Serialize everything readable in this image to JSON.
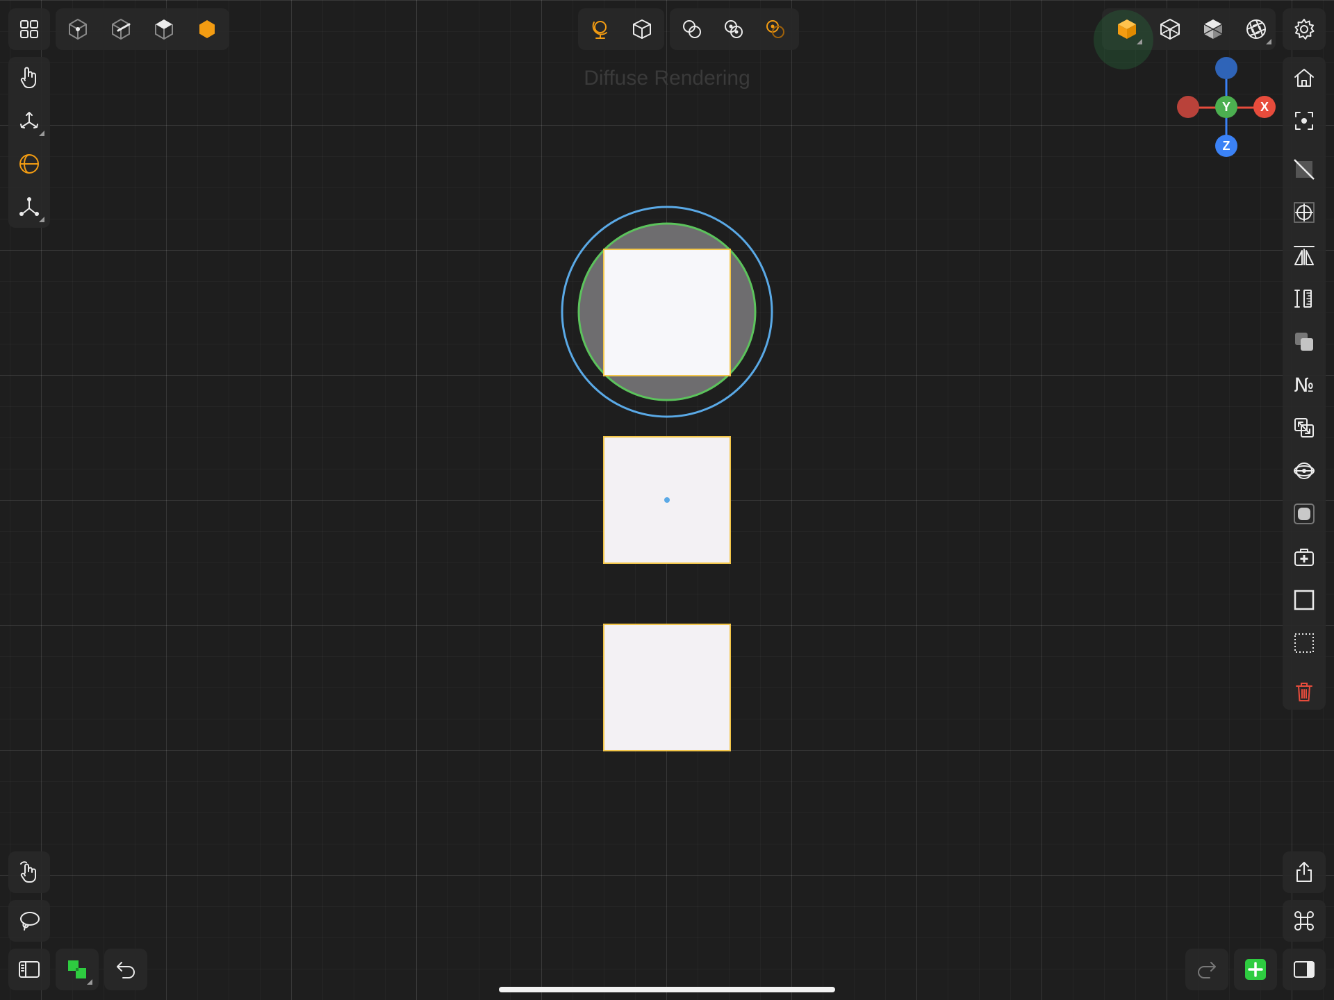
{
  "viewport": {
    "title": "Diffuse Rendering"
  },
  "gizmo": {
    "x_label": "X",
    "y_label": "Y",
    "z_label": "Z"
  },
  "colors": {
    "accent": "#f39c12",
    "axis_x": "#e74c3c",
    "axis_y": "#4caf50",
    "axis_z": "#3b82f6",
    "selection_outline": "#f3c64a",
    "circle_outer": "#5aa9e6",
    "circle_inner": "#5cc35c",
    "add_button": "#2ecc40",
    "delete": "#e74c3c"
  },
  "icons": {
    "top_left": [
      "grid-icon",
      "cube-vertex-icon",
      "cube-edge-icon",
      "cube-face-icon",
      "hexagon-object-icon"
    ],
    "top_center": [
      "globe-snap-icon",
      "cube-snap-icon",
      "circles-icon",
      "circles-dot-icon",
      "circles-orange-icon"
    ],
    "top_right": [
      "cube-solid-icon",
      "cube-wire-icon",
      "cube-shaded-icon",
      "aperture-icon",
      "settings-icon"
    ],
    "left": [
      "hand-icon",
      "move-axes-icon",
      "globe-icon",
      "axes-icon"
    ],
    "right": [
      "home-icon",
      "focus-icon",
      "hide-icon",
      "snap-target-icon",
      "mirror-icon",
      "measure-icon",
      "duplicate-icon",
      "number-icon",
      "merge-icon",
      "section-icon",
      "material-icon",
      "first-aid-icon",
      "square-icon",
      "dotted-square-icon",
      "trash-icon"
    ],
    "bottom_left": [
      "gesture-icon",
      "lasso-icon",
      "sidebar-left-icon",
      "layers-icon",
      "undo-icon"
    ],
    "bottom_right": [
      "share-icon",
      "command-icon",
      "redo-icon",
      "add-icon",
      "sidebar-right-icon"
    ]
  },
  "right_toolbar": {
    "number_label": "№"
  }
}
